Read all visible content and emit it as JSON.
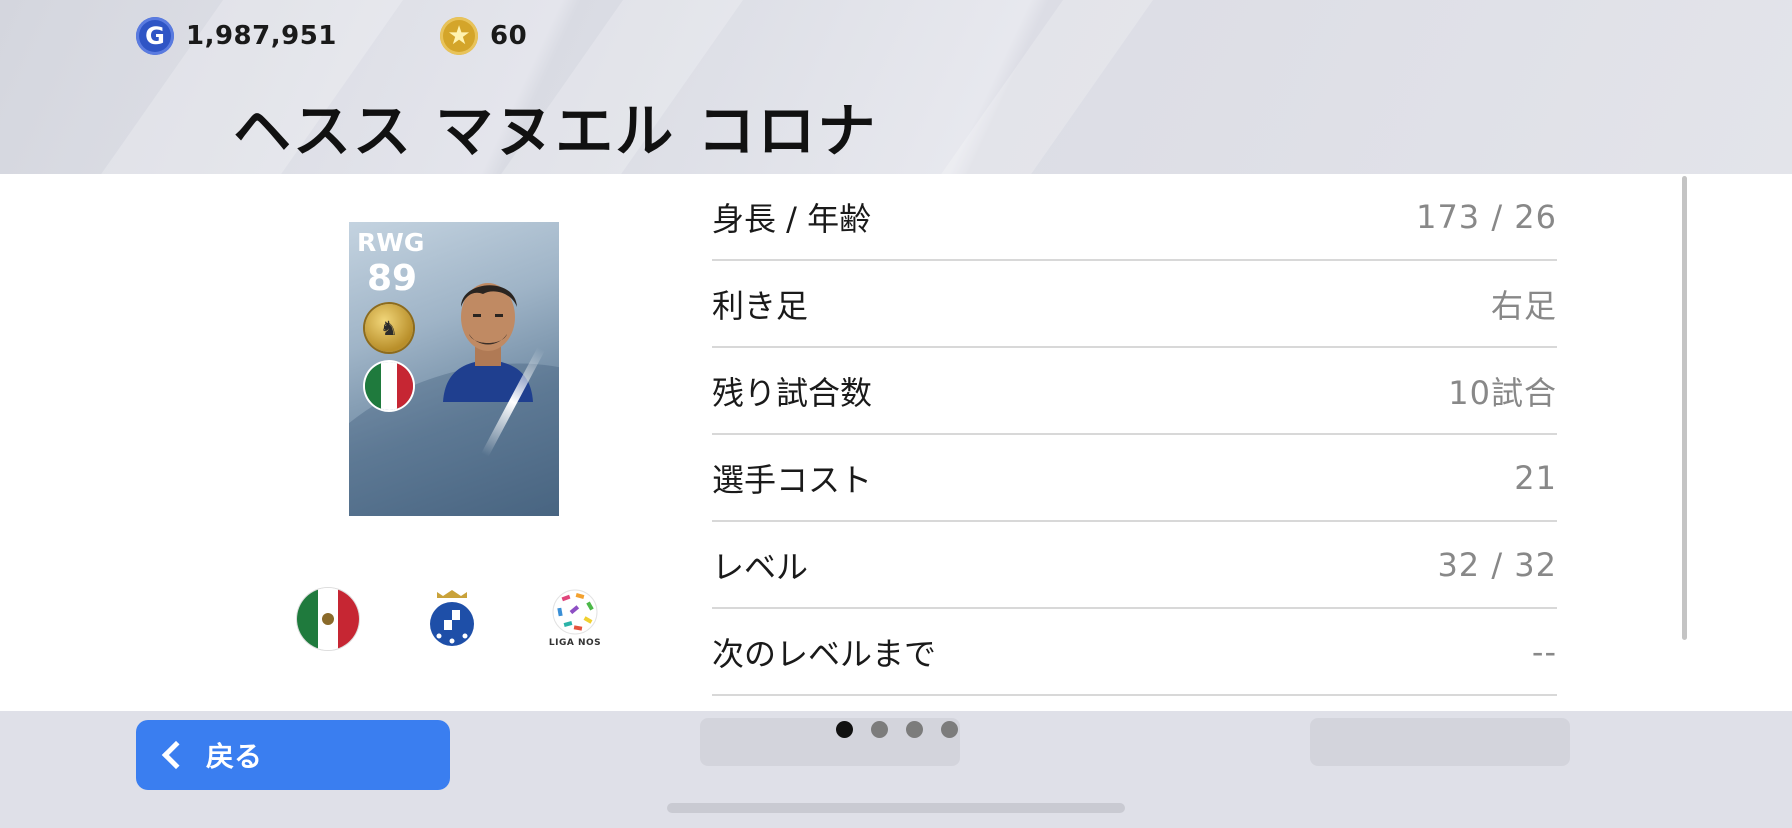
{
  "currency": {
    "gp": {
      "icon": "gp-coin-icon",
      "glyph": "G",
      "value": "1,987,951"
    },
    "coins": {
      "icon": "coin-star-icon",
      "glyph": "★",
      "value": "60"
    }
  },
  "player": {
    "name": "ヘスス マヌエル コロナ",
    "card": {
      "position": "RWG",
      "rating": "89"
    }
  },
  "affiliations": {
    "league_text": "LIGA NOS"
  },
  "stats": [
    {
      "label": "身長 / 年齢",
      "value": "173 / 26"
    },
    {
      "label": "利き足",
      "value": "右足"
    },
    {
      "label": "残り試合数",
      "value": "10試合"
    },
    {
      "label": "選手コスト",
      "value": "21"
    },
    {
      "label": "レベル",
      "value": "32 / 32"
    },
    {
      "label": "次のレベルまで",
      "value": "--"
    }
  ],
  "navigation": {
    "back_label": "戻る",
    "page_total": 4,
    "page_current": 1
  },
  "colors": {
    "accent": "#3a7ef0",
    "header_bg": "#dfe0e8",
    "panel_bg": "#ffffff"
  }
}
